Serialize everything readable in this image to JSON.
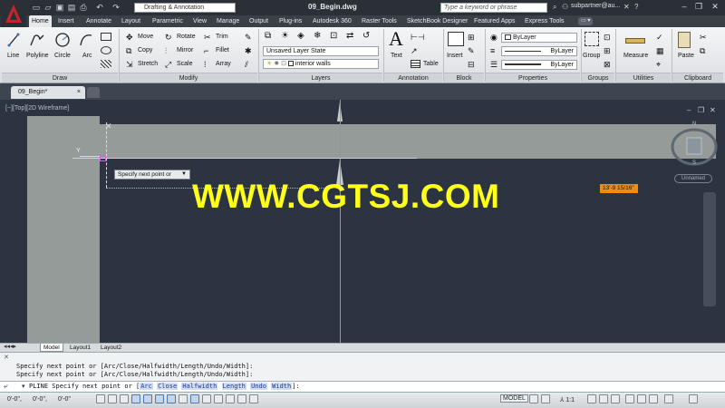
{
  "titlebar": {
    "workspace": "Drafting & Annotation",
    "document_title": "09_Begin.dwg",
    "search_placeholder": "Type a keyword or phrase",
    "user": "subpartner@au..."
  },
  "ribbon_tabs": [
    "Home",
    "Insert",
    "Annotate",
    "Layout",
    "Parametric",
    "View",
    "Manage",
    "Output",
    "Plug-ins",
    "Autodesk 360",
    "Raster Tools",
    "SketchBook Designer",
    "Featured Apps",
    "Express Tools"
  ],
  "active_tab": "Home",
  "draw": {
    "line": "Line",
    "polyline": "Polyline",
    "circle": "Circle",
    "arc": "Arc",
    "title": "Draw"
  },
  "modify": {
    "move": "Move",
    "rotate": "Rotate",
    "trim": "Trim",
    "copy": "Copy",
    "mirror": "Mirror",
    "fillet": "Fillet",
    "stretch": "Stretch",
    "scale": "Scale",
    "array": "Array",
    "title": "Modify"
  },
  "layers": {
    "state": "Unsaved Layer State",
    "current": "interior walls",
    "title": "Layers"
  },
  "annotation": {
    "text": "Text",
    "table": "Table",
    "title": "Annotation"
  },
  "block": {
    "insert": "Insert",
    "title": "Block"
  },
  "properties": {
    "color": "ByLayer",
    "linetype": "ByLayer",
    "lineweight": "ByLayer",
    "title": "Properties"
  },
  "groups": {
    "group": "Group",
    "title": "Groups"
  },
  "utilities": {
    "measure": "Measure",
    "title": "Utilities"
  },
  "clipboard": {
    "paste": "Paste",
    "title": "Clipboard"
  },
  "doc_tab": "09_Begin*",
  "viewport": {
    "label": "[−][Top][2D Wireframe]",
    "tooltip": "Specify next point or",
    "dimension_input": "13'-9 15/16\"",
    "watermark": "WWW.CGTSJ.COM",
    "ucs_y": "Y",
    "viewcube_top": "N",
    "viewcube_bottom": "S",
    "wcs": "Unnamed"
  },
  "layout_tabs": [
    "Model",
    "Layout1",
    "Layout2"
  ],
  "command": {
    "history": [
      "Specify next point or [Arc/Close/Halfwidth/Length/Undo/Width]:",
      "Specify next point or [Arc/Close/Halfwidth/Length/Undo/Width]:"
    ],
    "prompt_prefix": "PLINE Specify next point or [",
    "options": [
      "Arc",
      "Close",
      "Halfwidth",
      "Length",
      "Undo",
      "Width"
    ],
    "prompt_suffix": "]:"
  },
  "statusbar": {
    "coord_x": "0'-0\",",
    "coord_y": "0'-0\",",
    "coord_z": "0'-0\"",
    "model": "MODEL",
    "scale": "1:1"
  }
}
